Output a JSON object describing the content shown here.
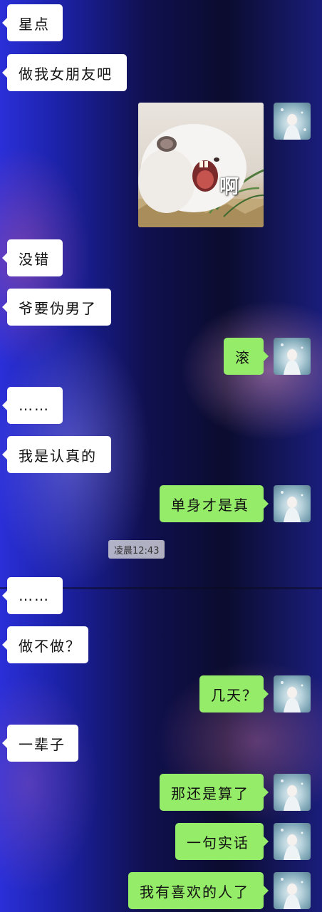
{
  "colors": {
    "incoming_bubble": "#ffffff",
    "outgoing_bubble": "#95ec69",
    "timestamp_bg": "#cdcdd7"
  },
  "messages": [
    {
      "from": "contact",
      "type": "text",
      "text": "星点"
    },
    {
      "from": "contact",
      "type": "text",
      "text": "做我女朋友吧"
    },
    {
      "from": "me",
      "type": "sticker",
      "icon": "hamster-screaming-sticker",
      "text": "啊"
    },
    {
      "from": "contact",
      "type": "text",
      "text": "没错"
    },
    {
      "from": "contact",
      "type": "text",
      "text": "爷要伪男了"
    },
    {
      "from": "me",
      "type": "text",
      "text": "滚"
    },
    {
      "from": "contact",
      "type": "text",
      "text": "……"
    },
    {
      "from": "contact",
      "type": "text",
      "text": "我是认真的"
    },
    {
      "from": "me",
      "type": "text",
      "text": "单身才是真"
    },
    {
      "type": "timestamp",
      "text": "凌晨12:43"
    },
    {
      "from": "contact",
      "type": "text",
      "text": "……"
    },
    {
      "from": "contact",
      "type": "text",
      "text": "做不做？"
    },
    {
      "from": "me",
      "type": "text",
      "text": "几天？"
    },
    {
      "from": "contact",
      "type": "text",
      "text": "一辈子"
    },
    {
      "from": "me",
      "type": "text",
      "text": "那还是算了"
    },
    {
      "from": "me",
      "type": "text",
      "text": "一句实话"
    },
    {
      "from": "me",
      "type": "text",
      "text": "我有喜欢的人了"
    }
  ]
}
